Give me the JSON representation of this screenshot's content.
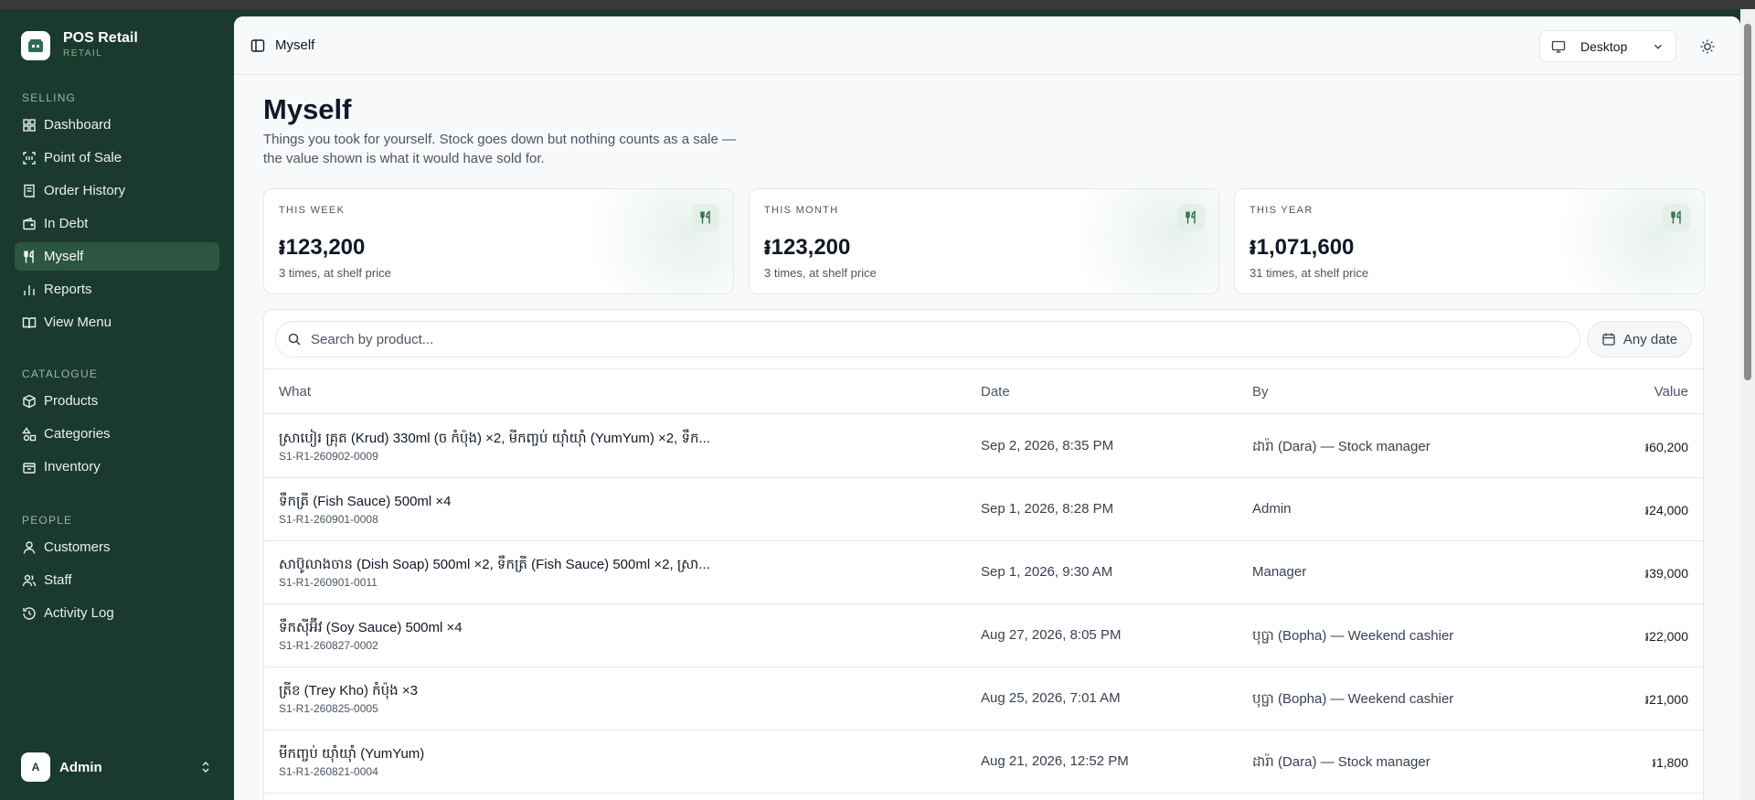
{
  "brand": {
    "name": "POS Retail",
    "sub": "RETAIL"
  },
  "sidebar": {
    "sections": [
      {
        "title": "SELLING",
        "items": [
          {
            "label": "Dashboard",
            "icon": "dashboard-icon"
          },
          {
            "label": "Point of Sale",
            "icon": "scan-icon"
          },
          {
            "label": "Order History",
            "icon": "receipt-icon"
          },
          {
            "label": "In Debt",
            "icon": "wallet-icon"
          },
          {
            "label": "Myself",
            "icon": "utensils-icon",
            "active": true
          },
          {
            "label": "Reports",
            "icon": "bar-chart-icon"
          },
          {
            "label": "View Menu",
            "icon": "book-icon"
          }
        ]
      },
      {
        "title": "CATALOGUE",
        "items": [
          {
            "label": "Products",
            "icon": "box-icon"
          },
          {
            "label": "Categories",
            "icon": "shapes-icon"
          },
          {
            "label": "Inventory",
            "icon": "package-icon"
          }
        ]
      },
      {
        "title": "PEOPLE",
        "items": [
          {
            "label": "Customers",
            "icon": "user-icon"
          },
          {
            "label": "Staff",
            "icon": "users-icon"
          },
          {
            "label": "Activity Log",
            "icon": "history-icon"
          }
        ]
      }
    ]
  },
  "user": {
    "initial": "A",
    "name": "Admin"
  },
  "header": {
    "breadcrumb": "Myself",
    "device": "Desktop"
  },
  "page": {
    "title": "Myself",
    "description": "Things you took for yourself. Stock goes down but nothing counts as a sale — the value shown is what it would have sold for."
  },
  "stats": [
    {
      "label": "THIS WEEK",
      "value": "៛123,200",
      "sub": "3 times, at shelf price"
    },
    {
      "label": "THIS MONTH",
      "value": "៛123,200",
      "sub": "3 times, at shelf price"
    },
    {
      "label": "THIS YEAR",
      "value": "៛1,071,600",
      "sub": "31 times, at shelf price"
    }
  ],
  "search": {
    "placeholder": "Search by product..."
  },
  "date_filter": {
    "label": "Any date"
  },
  "table": {
    "columns": {
      "what": "What",
      "date": "Date",
      "by": "By",
      "value": "Value"
    },
    "rows": [
      {
        "what": "ស្រាបៀរ គ្រុត (Krud) 330ml (ច កំប៉ុង) ×2, មីកញ្ចប់ យ៉ាំយ៉ាំ (YumYum) ×2, ទឹក...",
        "ref": "S1-R1-260902-0009",
        "date": "Sep 2, 2026, 8:35 PM",
        "by": "ដារ៉ា (Dara) — Stock manager",
        "value": "៛60,200"
      },
      {
        "what": "ទឹកត្រី (Fish Sauce) 500ml ×4",
        "ref": "S1-R1-260901-0008",
        "date": "Sep 1, 2026, 8:28 PM",
        "by": "Admin",
        "value": "៛24,000"
      },
      {
        "what": "សាប៊ូលាងចាន (Dish Soap) 500ml ×2, ទឹកត្រី (Fish Sauce) 500ml ×2, ស្រា...",
        "ref": "S1-R1-260901-0011",
        "date": "Sep 1, 2026, 9:30 AM",
        "by": "Manager",
        "value": "៛39,000"
      },
      {
        "what": "ទឹកស៊ីអ៊ីវ (Soy Sauce) 500ml ×4",
        "ref": "S1-R1-260827-0002",
        "date": "Aug 27, 2026, 8:05 PM",
        "by": "បុប្ផា (Bopha) — Weekend cashier",
        "value": "៛22,000"
      },
      {
        "what": "ត្រីខ (Trey Kho) កំប៉ុង ×3",
        "ref": "S1-R1-260825-0005",
        "date": "Aug 25, 2026, 7:01 AM",
        "by": "បុប្ផា (Bopha) — Weekend cashier",
        "value": "៛21,000"
      },
      {
        "what": "មីកញ្ចប់ យ៉ាំយ៉ាំ (YumYum)",
        "ref": "S1-R1-260821-0004",
        "date": "Aug 21, 2026, 12:52 PM",
        "by": "ដារ៉ា (Dara) — Stock manager",
        "value": "៛1,800"
      }
    ]
  },
  "colors": {
    "sidebar_bg": "#1b3a2e",
    "active_item": "#2d5543",
    "accent": "#2f6b4f"
  }
}
